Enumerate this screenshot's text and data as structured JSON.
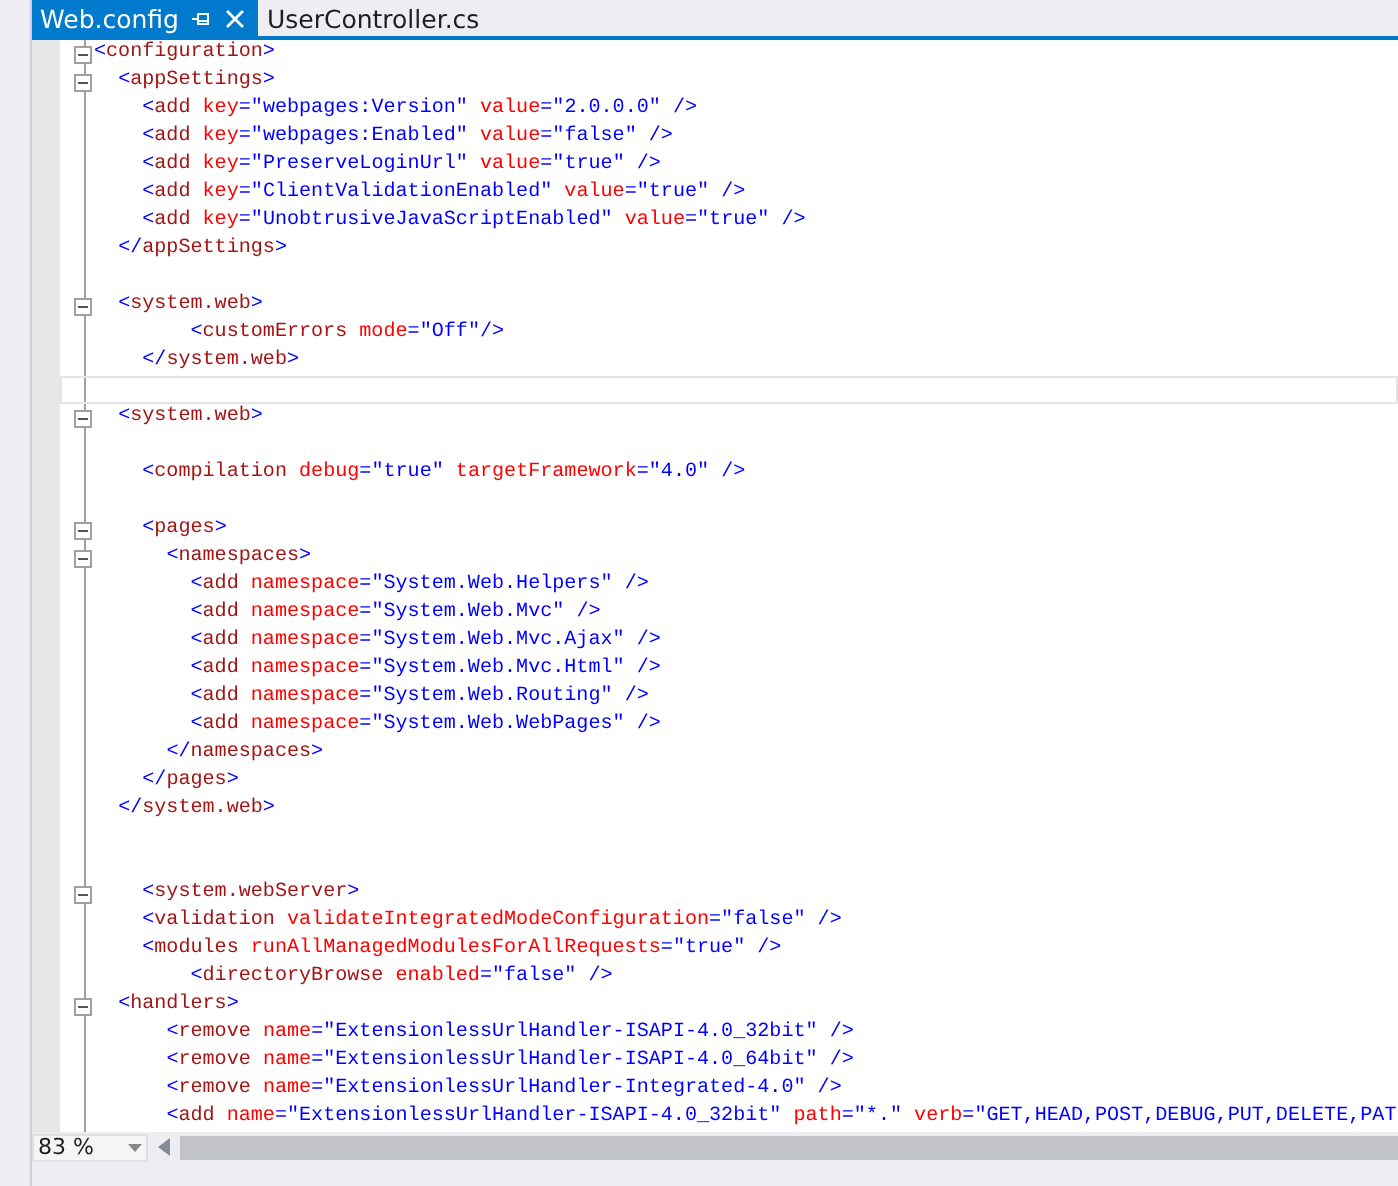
{
  "tabs": [
    {
      "label": "Web.config",
      "selected": true
    },
    {
      "label": "UserController.cs",
      "selected": false
    }
  ],
  "editor": {
    "lines": [
      {
        "kind": "code",
        "text": "<configuration>",
        "foldable": true,
        "current": false
      },
      {
        "kind": "code",
        "text": "  <appSettings>",
        "foldable": true,
        "current": false
      },
      {
        "kind": "code",
        "text": "    <add key=\"webpages:Version\" value=\"2.0.0.0\" />",
        "foldable": false,
        "current": false
      },
      {
        "kind": "code",
        "text": "    <add key=\"webpages:Enabled\" value=\"false\" />",
        "foldable": false,
        "current": false
      },
      {
        "kind": "code",
        "text": "    <add key=\"PreserveLoginUrl\" value=\"true\" />",
        "foldable": false,
        "current": false
      },
      {
        "kind": "code",
        "text": "    <add key=\"ClientValidationEnabled\" value=\"true\" />",
        "foldable": false,
        "current": false
      },
      {
        "kind": "code",
        "text": "    <add key=\"UnobtrusiveJavaScriptEnabled\" value=\"true\" />",
        "foldable": false,
        "current": false
      },
      {
        "kind": "code",
        "text": "  </appSettings>",
        "foldable": false,
        "current": false
      },
      {
        "kind": "blank",
        "foldable": false,
        "current": false
      },
      {
        "kind": "code",
        "text": "  <system.web>",
        "foldable": true,
        "current": false
      },
      {
        "kind": "code",
        "text": "        <customErrors mode=\"Off\"/>",
        "foldable": false,
        "current": false
      },
      {
        "kind": "code",
        "text": "    </system.web>",
        "foldable": false,
        "current": false
      },
      {
        "kind": "blank",
        "foldable": false,
        "current": true
      },
      {
        "kind": "code",
        "text": "  <system.web>",
        "foldable": true,
        "current": false
      },
      {
        "kind": "blank",
        "foldable": false,
        "current": false
      },
      {
        "kind": "code",
        "text": "    <compilation debug=\"true\" targetFramework=\"4.0\" />",
        "foldable": false,
        "current": false
      },
      {
        "kind": "blank",
        "foldable": false,
        "current": false
      },
      {
        "kind": "code",
        "text": "    <pages>",
        "foldable": true,
        "current": false
      },
      {
        "kind": "code",
        "text": "      <namespaces>",
        "foldable": true,
        "current": false
      },
      {
        "kind": "code",
        "text": "        <add namespace=\"System.Web.Helpers\" />",
        "foldable": false,
        "current": false
      },
      {
        "kind": "code",
        "text": "        <add namespace=\"System.Web.Mvc\" />",
        "foldable": false,
        "current": false
      },
      {
        "kind": "code",
        "text": "        <add namespace=\"System.Web.Mvc.Ajax\" />",
        "foldable": false,
        "current": false
      },
      {
        "kind": "code",
        "text": "        <add namespace=\"System.Web.Mvc.Html\" />",
        "foldable": false,
        "current": false
      },
      {
        "kind": "code",
        "text": "        <add namespace=\"System.Web.Routing\" />",
        "foldable": false,
        "current": false
      },
      {
        "kind": "code",
        "text": "        <add namespace=\"System.Web.WebPages\" />",
        "foldable": false,
        "current": false
      },
      {
        "kind": "code",
        "text": "      </namespaces>",
        "foldable": false,
        "current": false
      },
      {
        "kind": "code",
        "text": "    </pages>",
        "foldable": false,
        "current": false
      },
      {
        "kind": "code",
        "text": "  </system.web>",
        "foldable": false,
        "current": false
      },
      {
        "kind": "blank",
        "foldable": false,
        "current": false
      },
      {
        "kind": "blank",
        "foldable": false,
        "current": false
      },
      {
        "kind": "code",
        "text": "    <system.webServer>",
        "foldable": true,
        "current": false
      },
      {
        "kind": "code",
        "text": "    <validation validateIntegratedModeConfiguration=\"false\" />",
        "foldable": false,
        "current": false
      },
      {
        "kind": "code",
        "text": "    <modules runAllManagedModulesForAllRequests=\"true\" />",
        "foldable": false,
        "current": false
      },
      {
        "kind": "code",
        "text": "        <directoryBrowse enabled=\"false\" />",
        "foldable": false,
        "current": false
      },
      {
        "kind": "code",
        "text": "  <handlers>",
        "foldable": true,
        "current": false
      },
      {
        "kind": "code",
        "text": "      <remove name=\"ExtensionlessUrlHandler-ISAPI-4.0_32bit\" />",
        "foldable": false,
        "current": false
      },
      {
        "kind": "code",
        "text": "      <remove name=\"ExtensionlessUrlHandler-ISAPI-4.0_64bit\" />",
        "foldable": false,
        "current": false
      },
      {
        "kind": "code",
        "text": "      <remove name=\"ExtensionlessUrlHandler-Integrated-4.0\" />",
        "foldable": false,
        "current": false
      },
      {
        "kind": "code",
        "text": "      <add name=\"ExtensionlessUrlHandler-ISAPI-4.0_32bit\" path=\"*.\" verb=\"GET,HEAD,POST,DEBUG,PUT,DELETE,PAT",
        "foldable": false,
        "current": false
      }
    ]
  },
  "zoom": {
    "value": "83 %"
  }
}
